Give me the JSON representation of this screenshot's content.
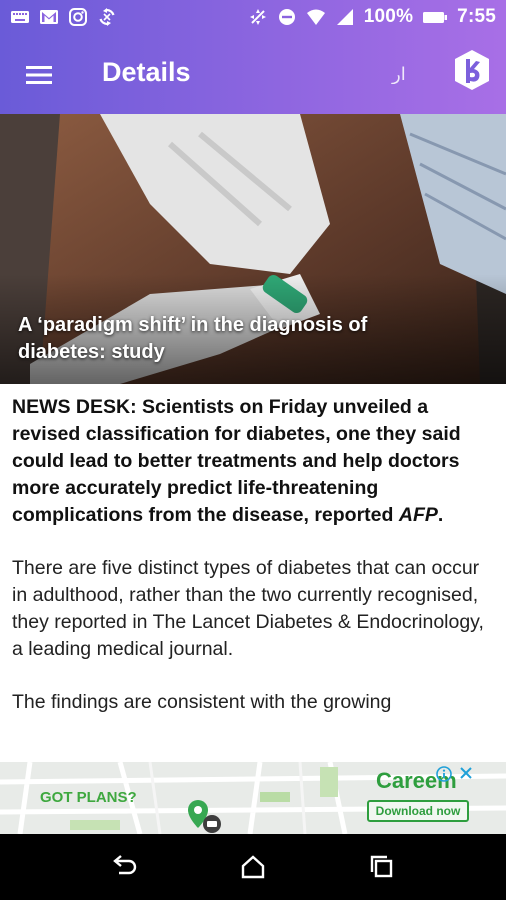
{
  "status_bar": {
    "battery_text": "100%",
    "time": "7:55",
    "left_icons": [
      "keyboard-icon",
      "gmail-icon",
      "instagram-icon",
      "sync-icon"
    ],
    "right_icons": [
      "data-saver-icon",
      "do-not-disturb-icon",
      "wifi-icon",
      "signal-icon",
      "battery-icon"
    ]
  },
  "app_bar": {
    "title": "Details",
    "language_toggle": "ار",
    "menu_icon": "hamburger-menu-icon",
    "logo_icon": "k-logo-icon"
  },
  "hero": {
    "caption": "A ‘paradigm shift’ in the diagnosis of diabetes: study"
  },
  "article": {
    "lead": "NEWS DESK: Scientists on Friday unveiled a revised classification for diabetes, one they said could lead to better treatments and help doctors more accurately predict life-threatening complications from the disease, reported ",
    "lead_source": "AFP",
    "lead_end": ".",
    "paragraph_1": "There are five distinct types of diabetes that can occur in adulthood, rather than the two currently recognised, they reported in The Lancet Diabetes & Endocrinology, a leading medical journal.",
    "paragraph_2": "The findings are consistent with the growing"
  },
  "ad": {
    "tagline": "GOT PLANS?",
    "brand": "Careem",
    "cta": "Download now"
  },
  "nav_bar": {
    "icons": [
      "back-icon",
      "home-icon",
      "recents-icon"
    ]
  },
  "colors": {
    "header_gradient_start": "#6a5bd8",
    "header_gradient_end": "#a86fe6",
    "ad_green": "#2e9e3e"
  }
}
